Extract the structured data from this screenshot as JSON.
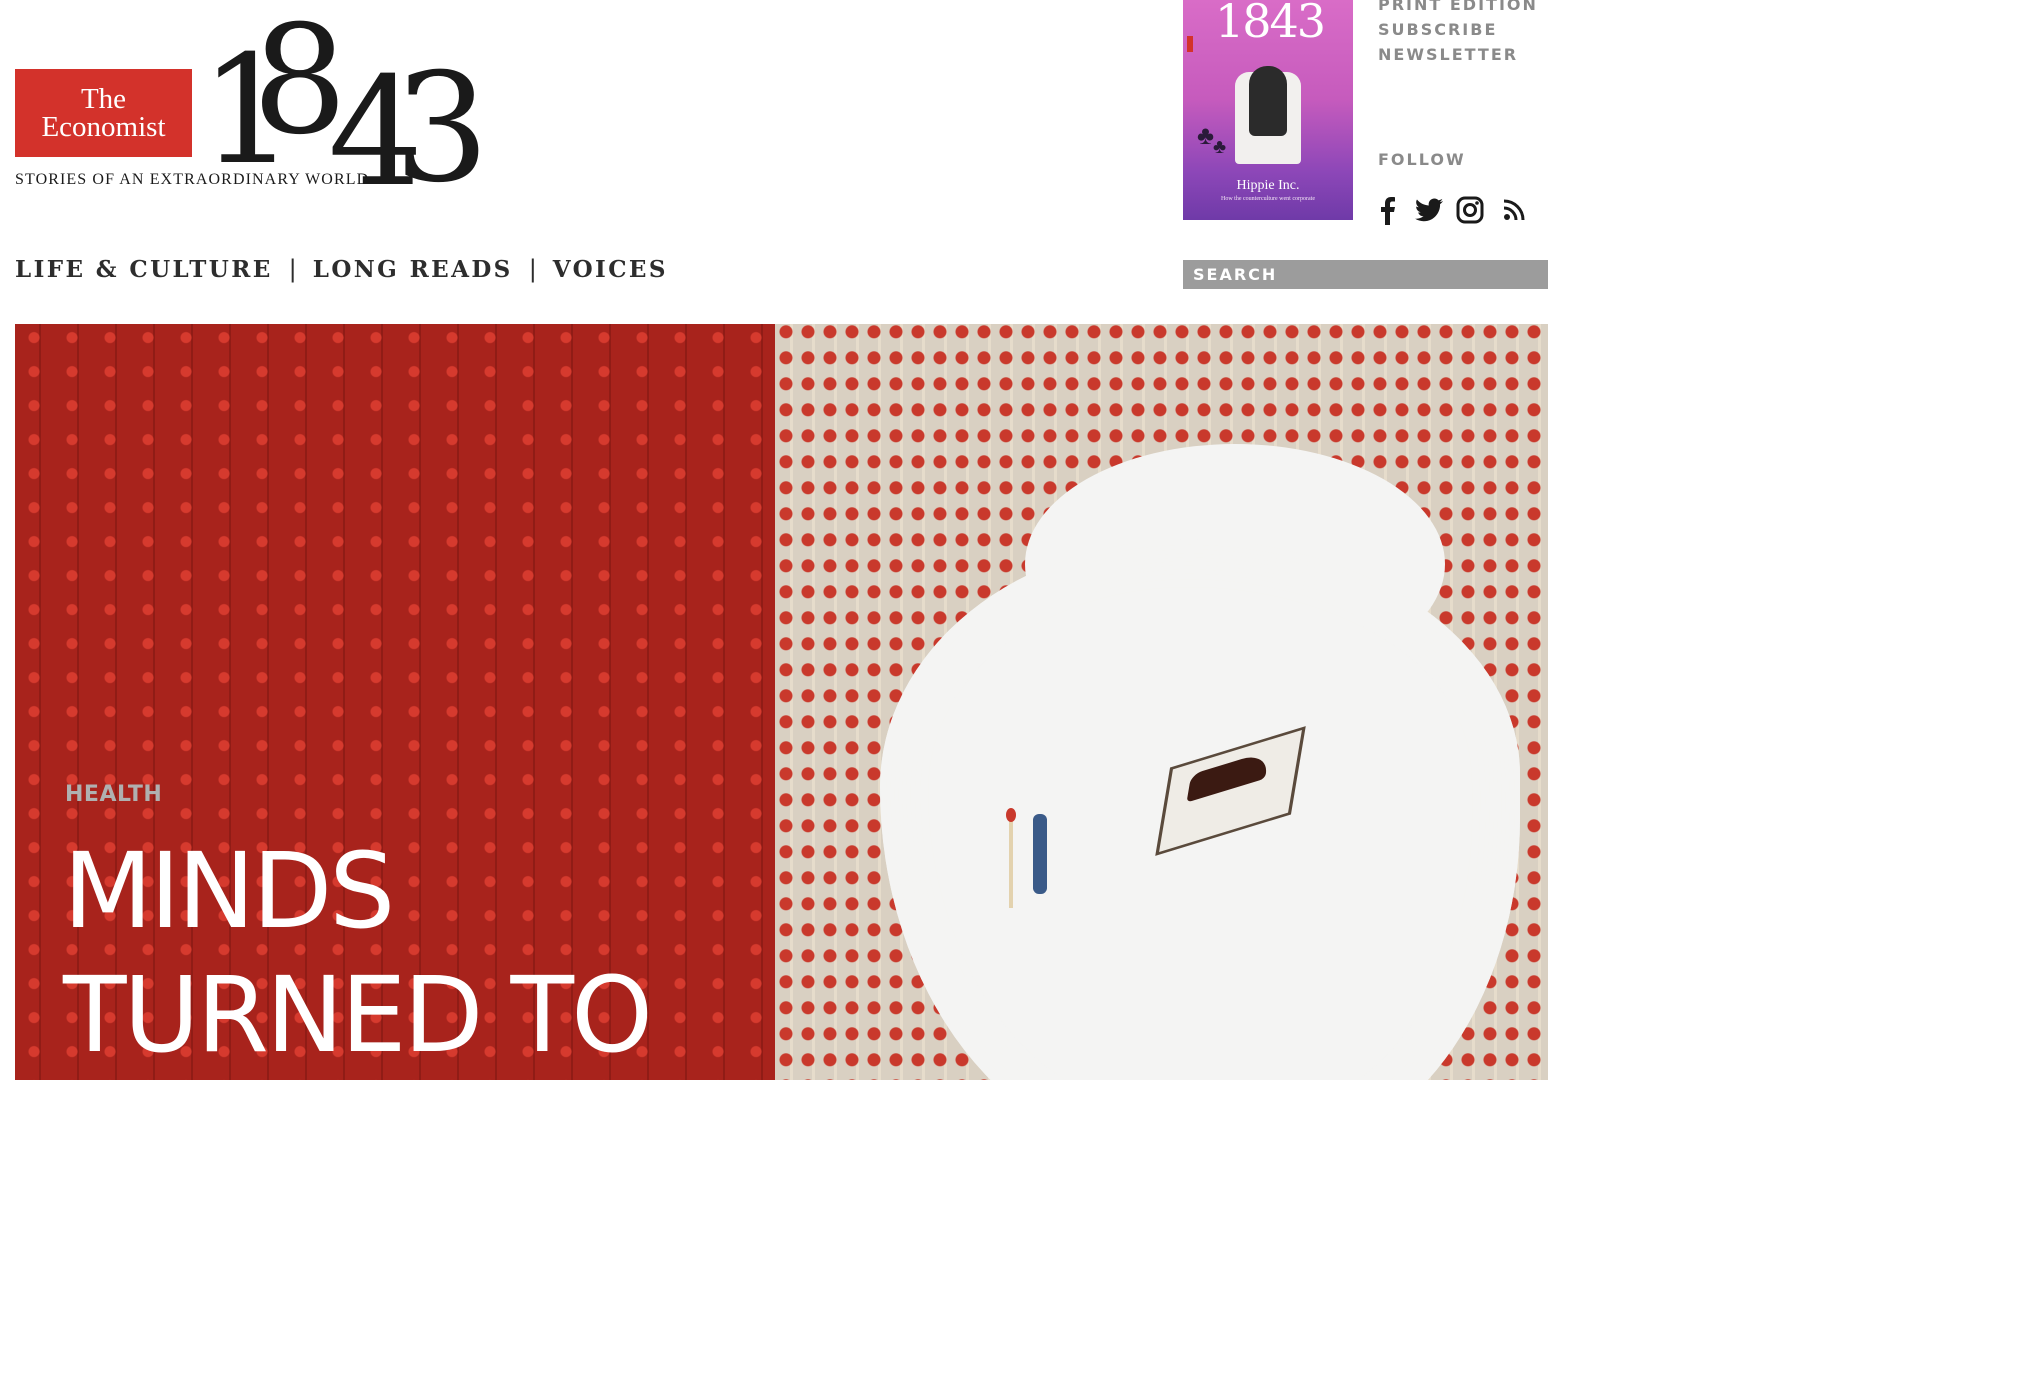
{
  "logo": {
    "brand_line1": "The",
    "brand_line2": "Economist",
    "issue_number": "1843",
    "tagline": "STORIES OF AN EXTRAORDINARY WORLD"
  },
  "cover": {
    "number": "1843",
    "title": "Hippie Inc.",
    "subtitle": "How the counterculture went corporate"
  },
  "side_links": [
    "PRINT EDITION",
    "SUBSCRIBE",
    "NEWSLETTER"
  ],
  "follow": {
    "label": "FOLLOW",
    "icons": [
      "facebook-icon",
      "twitter-icon",
      "instagram-icon",
      "rss-icon"
    ]
  },
  "nav": {
    "items": [
      "LIFE & CULTURE",
      "LONG READS",
      "VOICES"
    ],
    "separator": "|"
  },
  "search": {
    "placeholder": "SEARCH"
  },
  "hero": {
    "category": "HEALTH",
    "headline_line1": "MINDS",
    "headline_line2": "TURNED TO"
  },
  "colors": {
    "economist_red": "#d3322b",
    "hero_red": "#a8231c",
    "link_grey": "#8a8a8a",
    "search_grey": "#9c9c9c"
  }
}
